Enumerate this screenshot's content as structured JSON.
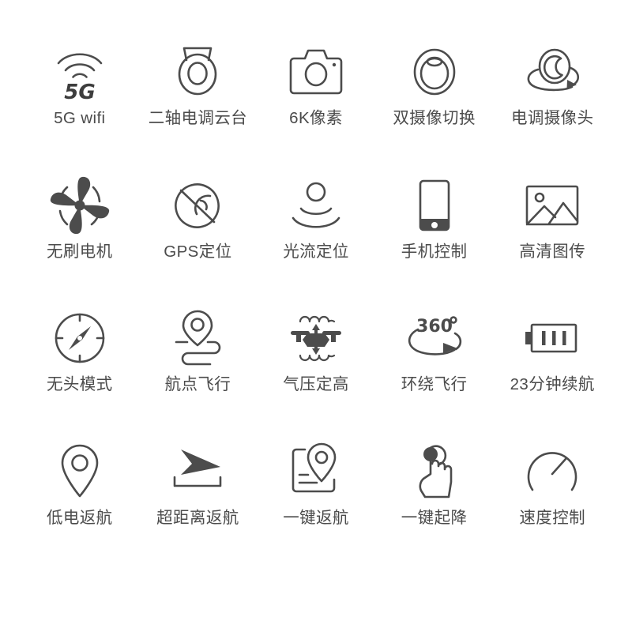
{
  "page": {
    "title": "Drone Feature Icon Grid",
    "background_color": "#ffffff",
    "icon_color": "#4c4c4c",
    "label_color": "#4b4b4b",
    "columns": 5,
    "rows": 4
  },
  "features": [
    {
      "label": "5G wifi",
      "icon": "wifi-5g-icon",
      "badge_text": "5G"
    },
    {
      "label": "二轴电调云台",
      "icon": "two-axis-gimbal-icon",
      "badge_text": ""
    },
    {
      "label": "6K像素",
      "icon": "camera-icon",
      "badge_text": ""
    },
    {
      "label": "双摄像切换",
      "icon": "dual-camera-switch-icon",
      "badge_text": ""
    },
    {
      "label": "电调摄像头",
      "icon": "rotating-camera-icon",
      "badge_text": ""
    },
    {
      "label": "无刷电机",
      "icon": "brushless-motor-icon",
      "badge_text": ""
    },
    {
      "label": "GPS定位",
      "icon": "gps-positioning-icon",
      "badge_text": ""
    },
    {
      "label": "光流定位",
      "icon": "optical-flow-icon",
      "badge_text": ""
    },
    {
      "label": "手机控制",
      "icon": "phone-control-icon",
      "badge_text": ""
    },
    {
      "label": "高清图传",
      "icon": "hd-image-transfer-icon",
      "badge_text": ""
    },
    {
      "label": "无头模式",
      "icon": "compass-headless-icon",
      "badge_text": ""
    },
    {
      "label": "航点飞行",
      "icon": "waypoint-flight-icon",
      "badge_text": ""
    },
    {
      "label": "气压定高",
      "icon": "altitude-hold-drone-icon",
      "badge_text": ""
    },
    {
      "label": "环绕飞行",
      "icon": "orbit-360-icon",
      "badge_text": "360"
    },
    {
      "label": "23分钟续航",
      "icon": "battery-icon",
      "badge_text": ""
    },
    {
      "label": "低电返航",
      "icon": "map-pin-icon",
      "badge_text": ""
    },
    {
      "label": "超距离返航",
      "icon": "long-distance-arrow-icon",
      "badge_text": ""
    },
    {
      "label": "一键返航",
      "icon": "one-key-return-map-icon",
      "badge_text": ""
    },
    {
      "label": "一键起降",
      "icon": "one-key-takeoff-hand-icon",
      "badge_text": ""
    },
    {
      "label": "速度控制",
      "icon": "speed-gauge-icon",
      "badge_text": ""
    }
  ]
}
